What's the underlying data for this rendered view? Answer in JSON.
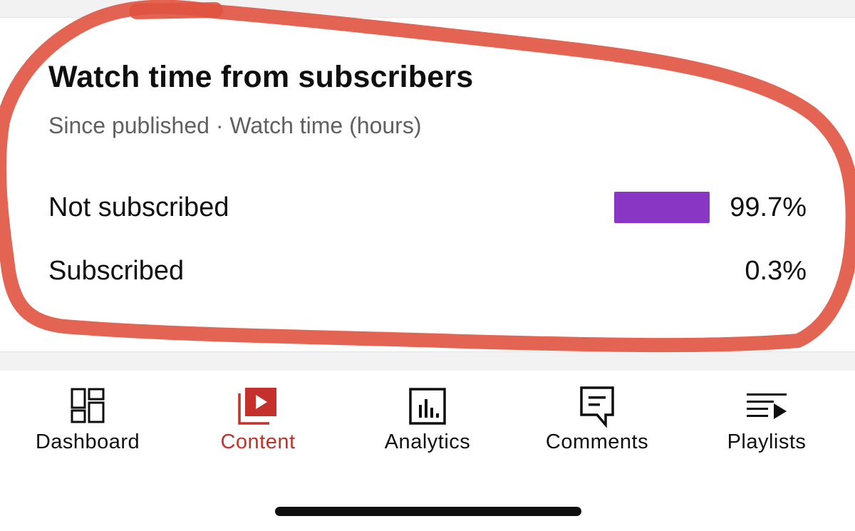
{
  "card": {
    "title": "Watch time from subscribers",
    "subtitle": "Since published · Watch time (hours)",
    "rows": [
      {
        "label": "Not subscribed",
        "value": "99.7%",
        "fraction": 0.997,
        "bar_color": "#8a36c5"
      },
      {
        "label": "Subscribed",
        "value": "0.3%",
        "fraction": 0.003,
        "bar_color": "#8a36c5"
      }
    ]
  },
  "bottom_nav": {
    "items": [
      {
        "label": "Dashboard",
        "icon": "dashboard-icon",
        "active": false
      },
      {
        "label": "Content",
        "icon": "content-icon",
        "active": true
      },
      {
        "label": "Analytics",
        "icon": "analytics-icon",
        "active": false
      },
      {
        "label": "Comments",
        "icon": "comments-icon",
        "active": false
      },
      {
        "label": "Playlists",
        "icon": "playlists-icon",
        "active": false
      }
    ]
  },
  "colors": {
    "accent": "#c4302b",
    "bar": "#8a36c5",
    "annotation": "#e0533f",
    "text": "#0f0f0f",
    "muted_text": "#606060"
  }
}
